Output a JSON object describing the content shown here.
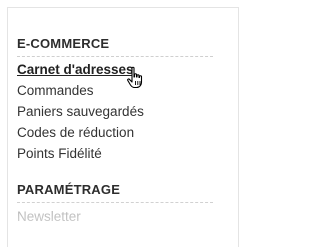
{
  "sections": [
    {
      "title": "E-COMMERCE",
      "items": [
        {
          "label": "Carnet d'adresses",
          "active": true
        },
        {
          "label": "Commandes"
        },
        {
          "label": "Paniers sauvegardés"
        },
        {
          "label": "Codes de réduction"
        },
        {
          "label": "Points Fidélité"
        }
      ]
    },
    {
      "title": "PARAMÉTRAGE",
      "items": [
        {
          "label": "Newsletter",
          "faded": true
        }
      ]
    }
  ],
  "cursor": {
    "icon": "hand-pointer-icon"
  }
}
